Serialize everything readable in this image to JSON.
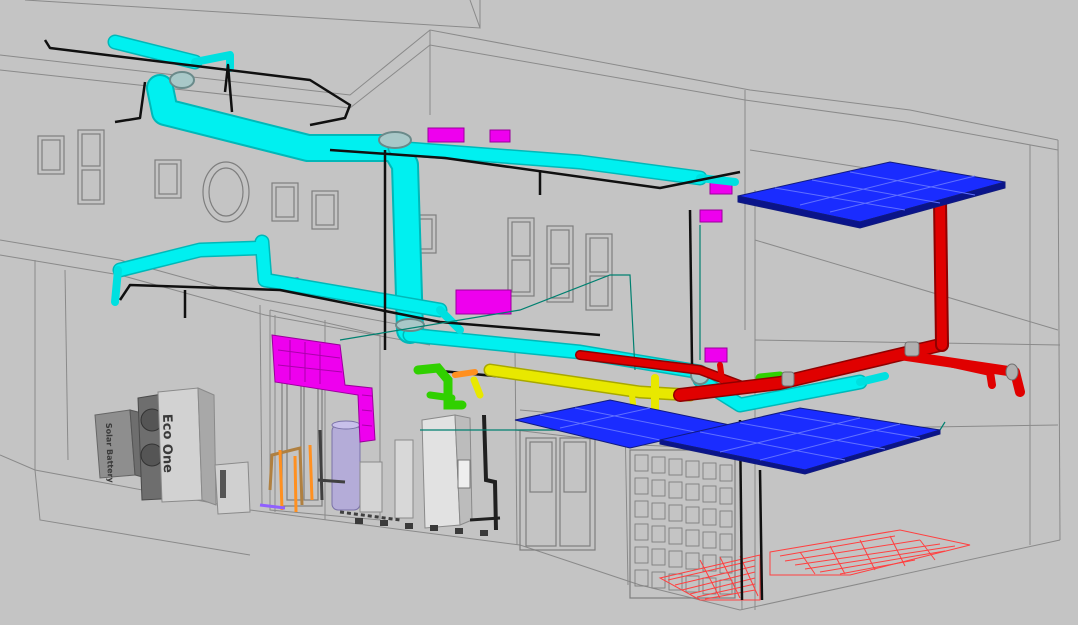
{
  "diagram": {
    "background_color": "#c4c4c4",
    "systems": [
      {
        "name": "supply-air-duct",
        "color": "#00f0f0"
      },
      {
        "name": "heating-flow-pipe",
        "color": "#e00000"
      },
      {
        "name": "heat-pump-circuit-pipe",
        "color": "#e8e800"
      },
      {
        "name": "manifold-fittings",
        "color": "#30d000"
      },
      {
        "name": "extract-fan-housing",
        "color": "#ee00ee"
      },
      {
        "name": "solar-panel",
        "color": "#1428ff"
      },
      {
        "name": "underfloor-heating-loop",
        "color": "#ff4040"
      },
      {
        "name": "control-cable",
        "color": "#101010"
      },
      {
        "name": "building-outline",
        "color": "#8a8a8a"
      }
    ],
    "equipment_labels": {
      "battery": "Solar Battery",
      "ecoone_top": "Eco",
      "ecoone_bottom": "One"
    }
  }
}
